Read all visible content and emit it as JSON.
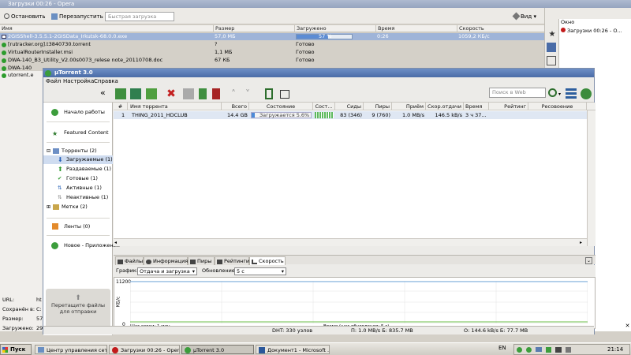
{
  "opera": {
    "title": "Загрузки 00:26 - Opera",
    "toolbar": {
      "stop": "Остановить",
      "restart": "Перезапустить",
      "search_placeholder": "Быстрая загрузка",
      "view": "Вид"
    },
    "columns": [
      "Имя",
      "Размер",
      "Загружено",
      "Время",
      "Скорость"
    ],
    "rows": [
      {
        "name": "2GISShell-3.5.5.1-2GISData_Irkutsk-68.0.0.exe",
        "size": "57,0 МБ",
        "progress": 0.57,
        "progress_label": "57 %",
        "time": "0:26",
        "speed": "1059,2 КБ/с"
      },
      {
        "name": "[rutracker.org].t3840730.torrent",
        "size": "?",
        "status": "Готово"
      },
      {
        "name": "VirtualRouterInstaller.msi",
        "size": "1,1 МБ",
        "status": "Готово"
      },
      {
        "name": "DWA-140_B3_Utility_V2.00s0073_relese note_20110708.doc",
        "size": "67 КБ",
        "status": "Готово"
      },
      {
        "name": "DWA-140",
        "size": "",
        "status": ""
      },
      {
        "name": "utorrent.e",
        "size": "",
        "status": ""
      }
    ],
    "info_labels": [
      "URL:",
      "Сохранён в:",
      "Размер:",
      "Загружено:"
    ],
    "info_values": [
      "ht",
      "C:",
      "57",
      "29"
    ],
    "right_panel": {
      "header": "Окно",
      "item": "Загрузки 00:26 - О..."
    }
  },
  "utorrent": {
    "title": "µTorrent 3.0",
    "menu": [
      "Файл",
      "Настройка",
      "Справка"
    ],
    "search_placeholder": "Поиск в Web",
    "sidebar": {
      "start": "Начало работы",
      "featured": "Featured Content",
      "torrents": "Торренты (2)",
      "items": [
        "Загружаемые (1)",
        "Раздаваемые (1)",
        "Готовые (1)",
        "Активные (1)",
        "Неактивные (1)"
      ],
      "labels": "Метки (2)",
      "feeds": "Ленты (0)",
      "apps": "Новое - Приложения",
      "drop": "Перетащите файлы для отправки"
    },
    "list_columns": [
      "#",
      "Имя торрента",
      "Всего",
      "Состояние",
      "Сост...",
      "Сиды",
      "Пиры",
      "Приём",
      "Скор.отдачи",
      "Время",
      "Рейтинг",
      "Ресовоение"
    ],
    "torrent": {
      "num": "1",
      "name": "THING_2011_HDCLUB",
      "size": "14.4 GB",
      "status": "Загружается 5.6%",
      "progress": 0.056,
      "seeds": "83 (346)",
      "peers": "9 (760)",
      "down": "1.0 MB/s",
      "up": "146.5 kB/s",
      "eta": "3 ч 37..."
    },
    "tabs": [
      "Файлы",
      "Информация",
      "Пиры",
      "Рейтинги",
      "Скорость"
    ],
    "graph": {
      "label": "График:",
      "mode": "Отдача и загрузка",
      "refresh_label": "Обновление:",
      "refresh": "5 с",
      "ymax": "11200",
      "yzero": "0",
      "yunit": "КБ/с",
      "step_left": "Шаг сетки: 1 мин",
      "step_right": "Время (шаг обновления: 5 с)"
    },
    "status": {
      "dht": "DHT: 330 узлов",
      "down": "П: 1.0 MB/s Б: 835.7 MB",
      "up": "О: 144.6 kB/s Б: 77.7 MB"
    }
  },
  "taskbar": {
    "start": "Пуск",
    "tasks": [
      "Центр управления сет...",
      "Загрузки 00:26 - Opera",
      "µTorrent 3.0",
      "Документ1 - Microsoft ..."
    ],
    "lang": "EN",
    "clock": "21:14"
  }
}
